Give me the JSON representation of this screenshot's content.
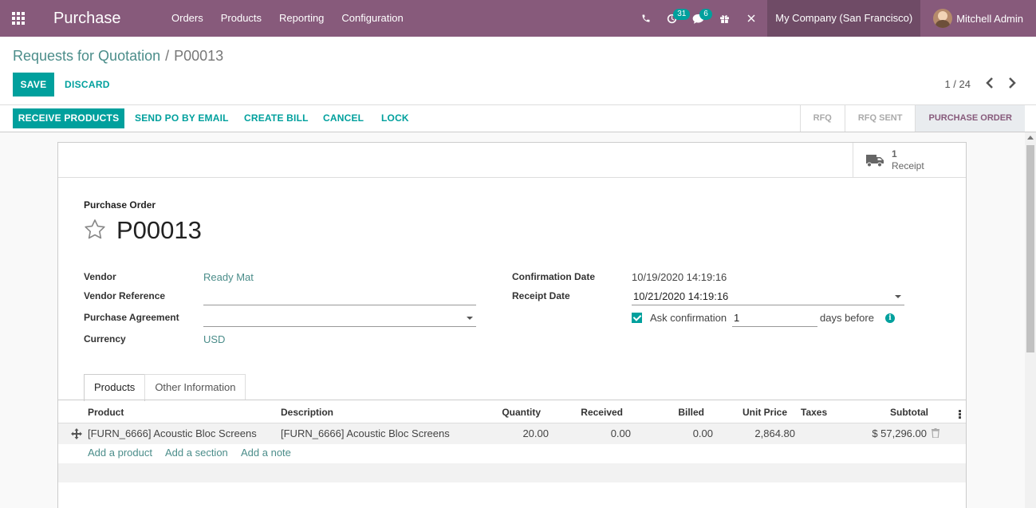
{
  "navbar": {
    "brand": "Purchase",
    "menu": [
      "Orders",
      "Products",
      "Reporting",
      "Configuration"
    ],
    "activity_count": "31",
    "message_count": "6",
    "company": "My Company (San Francisco)",
    "user": "Mitchell Admin"
  },
  "control_panel": {
    "breadcrumb_parent": "Requests for Quotation",
    "breadcrumb_separator": "/",
    "breadcrumb_current": "P00013",
    "save_label": "SAVE",
    "discard_label": "DISCARD",
    "pager": "1 / 24"
  },
  "statusbar": {
    "buttons": [
      "RECEIVE PRODUCTS",
      "SEND PO BY EMAIL",
      "CREATE BILL",
      "CANCEL",
      "LOCK"
    ],
    "stages": [
      "RFQ",
      "RFQ SENT",
      "PURCHASE ORDER"
    ],
    "active_stage": "PURCHASE ORDER"
  },
  "smart_button": {
    "count": "1",
    "label": "Receipt"
  },
  "form": {
    "doc_label": "Purchase Order",
    "doc_name": "P00013",
    "vendor_label": "Vendor",
    "vendor": "Ready Mat",
    "vendor_ref_label": "Vendor Reference",
    "vendor_ref": "",
    "agreement_label": "Purchase Agreement",
    "agreement": "",
    "currency_label": "Currency",
    "currency": "USD",
    "confirmation_date_label": "Confirmation Date",
    "confirmation_date": "10/19/2020 14:19:16",
    "receipt_date_label": "Receipt Date",
    "receipt_date": "10/21/2020 14:19:16",
    "ask_confirmation_label": "Ask confirmation",
    "ask_confirmation_checked": true,
    "ask_confirmation_days": "1",
    "days_before_label": "days before"
  },
  "tabs": [
    "Products",
    "Other Information"
  ],
  "active_tab": "Products",
  "order_lines": {
    "columns": [
      "Product",
      "Description",
      "Quantity",
      "Received",
      "Billed",
      "Unit Price",
      "Taxes",
      "Subtotal"
    ],
    "rows": [
      {
        "product": "[FURN_6666] Acoustic Bloc Screens",
        "description": "[FURN_6666] Acoustic Bloc Screens",
        "quantity": "20.00",
        "received": "0.00",
        "billed": "0.00",
        "unit_price": "2,864.80",
        "taxes": "",
        "subtotal": "$ 57,296.00"
      }
    ],
    "add_links": [
      "Add a product",
      "Add a section",
      "Add a note"
    ]
  },
  "colors": {
    "brand": "#875a7b",
    "accent": "#00a09d",
    "link": "#4b8d8a"
  },
  "icons": [
    "apps-grid-icon",
    "phone-icon",
    "clock-icon",
    "chat-icon",
    "gift-icon",
    "close-icon",
    "truck-icon",
    "star-icon",
    "move-icon",
    "trash-icon",
    "info-icon",
    "chevron-left-icon",
    "chevron-right-icon"
  ]
}
